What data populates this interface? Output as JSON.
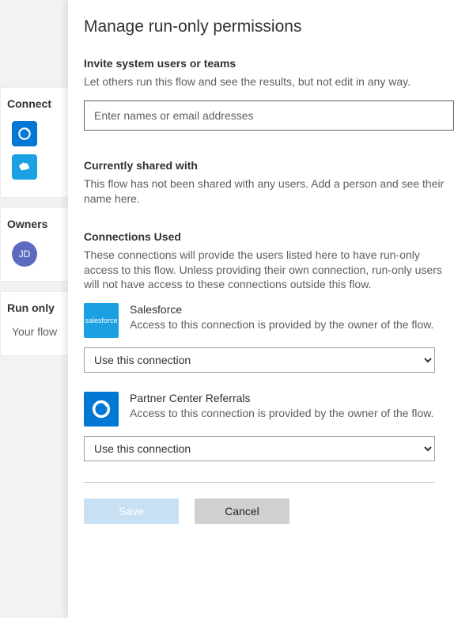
{
  "bg": {
    "connect_title": "Connect",
    "owners_title": "Owners",
    "owner_initials": "JD",
    "runonly_title": "Run only",
    "runonly_text": "Your flow"
  },
  "panel": {
    "title": "Manage run-only permissions",
    "invite": {
      "heading": "Invite system users or teams",
      "desc": "Let others run this flow and see the results, but not edit in any way.",
      "placeholder": "Enter names or email addresses"
    },
    "shared": {
      "heading": "Currently shared with",
      "desc": "This flow has not been shared with any users. Add a person and see their name here."
    },
    "connections": {
      "heading": "Connections Used",
      "desc": "These connections will provide the users listed here to have run-only access to this flow. Unless providing their own connection, run-only users will not have access to these connections outside this flow.",
      "items": [
        {
          "name": "Salesforce",
          "desc": "Access to this connection is provided by the owner of the flow.",
          "select_value": "Use this connection"
        },
        {
          "name": "Partner Center Referrals",
          "desc": "Access to this connection is provided by the owner of the flow.",
          "select_value": "Use this connection"
        }
      ]
    },
    "buttons": {
      "save": "Save",
      "cancel": "Cancel"
    }
  }
}
